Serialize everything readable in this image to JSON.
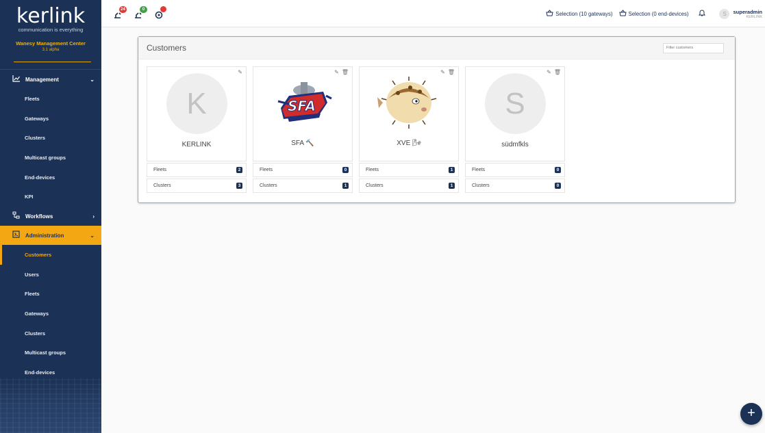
{
  "brand": {
    "logo": "kerlink",
    "tagline": "communication is everything",
    "app_name": "Wanesy Management Center",
    "version": "3.1 alpha"
  },
  "sidebar": {
    "sections": [
      {
        "label": "Management",
        "icon": "chart-line-icon",
        "chevron": "down",
        "items": [
          "Fleets",
          "Gateways",
          "Clusters",
          "Multicast groups",
          "End-devices",
          "KPI"
        ]
      },
      {
        "label": "Workflows",
        "icon": "workflow-icon",
        "chevron": "right",
        "items": []
      },
      {
        "label": "Administration",
        "icon": "admin-box-icon",
        "chevron": "down",
        "active": true,
        "items": [
          "Customers",
          "Users",
          "Fleets",
          "Gateways",
          "Clusters",
          "Multicast groups",
          "End-devices"
        ],
        "active_item": "Customers"
      }
    ]
  },
  "topbar": {
    "notifications": [
      {
        "icon": "gateway-alert-icon",
        "badge": "24",
        "badge_color": "#e53935"
      },
      {
        "icon": "gateway-ok-icon",
        "badge": "0",
        "badge_color": "#43a047"
      },
      {
        "icon": "device-alert-icon",
        "badge": "",
        "badge_color": "#e53935"
      }
    ],
    "selection_gateways": "Selection (10 gateways)",
    "selection_devices": "Selection (0 end-devices)",
    "user": {
      "initial": "S",
      "name": "superadmin",
      "org": "KERLINK"
    }
  },
  "panel": {
    "title": "Customers",
    "filter_placeholder": "Filter customers"
  },
  "customers": [
    {
      "name": "KERLINK",
      "initial": "K",
      "logo": "letter-avatar",
      "fleets_label": "Fleets",
      "fleets": "2",
      "clusters_label": "Clusters",
      "clusters": "3",
      "deletable": false
    },
    {
      "name": "SFA",
      "emoji": "🔨",
      "logo": "sfa-lumberjacks-logo",
      "fleets_label": "Fleets",
      "fleets": "0",
      "clusters_label": "Clusters",
      "clusters": "1",
      "deletable": true
    },
    {
      "name": "XVE",
      "emoji": "🌬",
      "logo": "pufferfish-image",
      "fleets_label": "Fleets",
      "fleets": "1",
      "clusters_label": "Clusters",
      "clusters": "1",
      "deletable": true
    },
    {
      "name": "südmfkls",
      "initial": "S",
      "logo": "letter-avatar",
      "fleets_label": "Fleets",
      "fleets": "0",
      "clusters_label": "Clusters",
      "clusters": "0",
      "deletable": true
    }
  ],
  "fab": {
    "label": "+"
  },
  "colors": {
    "navy": "#1b3155",
    "accent": "#f3a712"
  }
}
